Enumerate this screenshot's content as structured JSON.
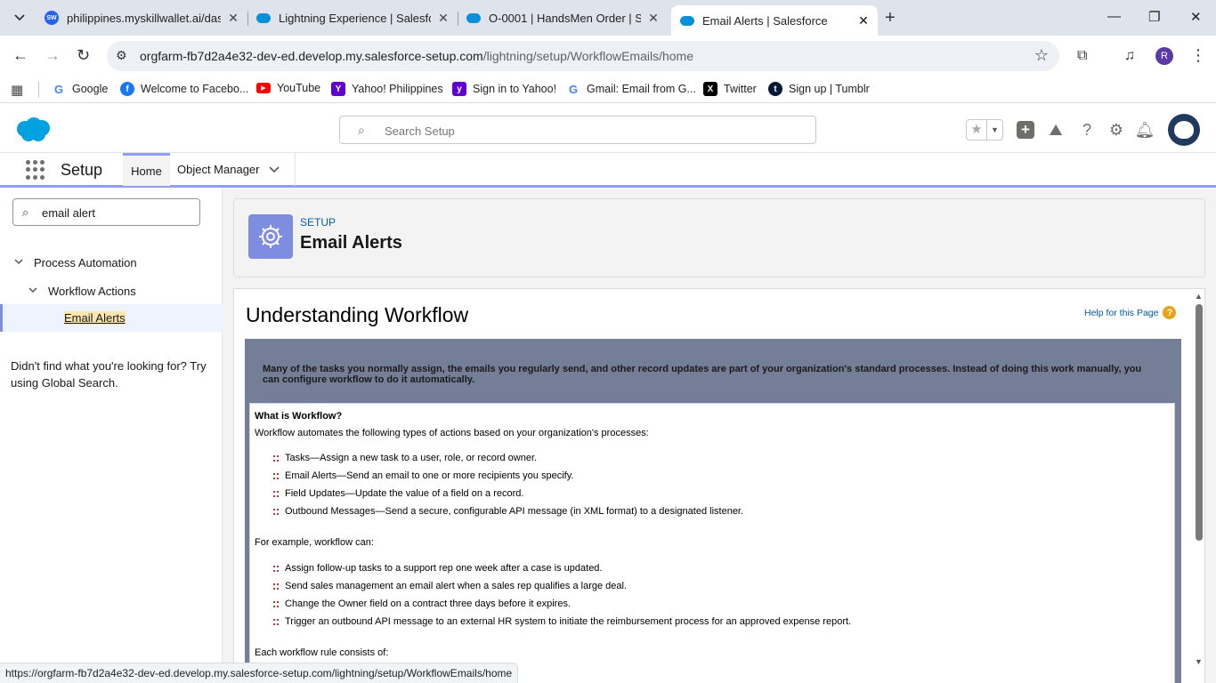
{
  "browser": {
    "tabs": [
      {
        "title": "philippines.myskillwallet.ai/dash",
        "icon": "skillwallet-icon"
      },
      {
        "title": "Lightning Experience | Salesforc",
        "icon": "salesforce-cloud-icon"
      },
      {
        "title": "O-0001 | HandsMen Order | Sal",
        "icon": "salesforce-cloud-icon"
      },
      {
        "title": "Email Alerts | Salesforce",
        "icon": "salesforce-cloud-icon",
        "active": true
      }
    ],
    "favicon_text": "SW",
    "url_host": "orgfarm-fb7d2a4e32-dev-ed.develop.my.salesforce-setup.com",
    "url_path": "/lightning/setup/WorkflowEmails/home",
    "profile_initial": "R",
    "bookmarks": [
      {
        "label": "Google",
        "icon": "google-icon",
        "color": "#4285f4",
        "glyph": "G"
      },
      {
        "label": "Welcome to Facebo...",
        "icon": "facebook-icon",
        "color": "#1877f2",
        "glyph": "f"
      },
      {
        "label": "YouTube",
        "icon": "youtube-icon",
        "color": "#ff0000",
        "glyph": "▶"
      },
      {
        "label": "Yahoo! Philippines",
        "icon": "yahoo-icon",
        "color": "#5f01d1",
        "glyph": "Y"
      },
      {
        "label": "Sign in to Yahoo!",
        "icon": "yahoo-icon",
        "color": "#6001d2",
        "glyph": "y"
      },
      {
        "label": "Gmail: Email from G...",
        "icon": "google-icon",
        "color": "#4285f4",
        "glyph": "G"
      },
      {
        "label": "Twitter",
        "icon": "x-icon",
        "color": "#000000",
        "glyph": "X"
      },
      {
        "label": "Sign up | Tumblr",
        "icon": "tumblr-icon",
        "color": "#001935",
        "glyph": "t"
      }
    ],
    "status_url": "https://orgfarm-fb7d2a4e32-dev-ed.develop.my.salesforce-setup.com/lightning/setup/WorkflowEmails/home"
  },
  "sf_header": {
    "search_placeholder": "Search Setup",
    "brand_color": "#00a1e0"
  },
  "setup_nav": {
    "title": "Setup",
    "home_label": "Home",
    "object_manager_label": "Object Manager"
  },
  "sidebar": {
    "quickfind_value": "email alert",
    "tree": {
      "level1": "Process Automation",
      "level2": "Workflow Actions",
      "level3": "Email Alerts"
    },
    "not_found_text": "Didn't find what you're looking for? Try using Global Search."
  },
  "page_header": {
    "eyebrow": "SETUP",
    "title": "Email Alerts"
  },
  "content": {
    "title": "Understanding Workflow",
    "help_link": "Help for this Page",
    "intro": "Many of the tasks you normally assign, the emails you regularly send, and other record updates are part of your organization's standard processes. Instead of doing this work manually, you can configure workflow to do it automatically.",
    "what_heading": "What is Workflow?",
    "what_text": "Workflow automates the following types of actions based on your organization's processes:",
    "action_types": [
      "Tasks—Assign a new task to a user, role, or record owner.",
      "Email Alerts—Send an email to one or more recipients you specify.",
      "Field Updates—Update the value of a field on a record.",
      "Outbound Messages—Send a secure, configurable API message (in XML format) to a designated listener."
    ],
    "example_intro": "For example, workflow can:",
    "examples": [
      "Assign follow-up tasks to a support rep one week after a case is updated.",
      "Send sales management an email alert when a sales rep qualifies a large deal.",
      "Change the Owner field on a contract three days before it expires.",
      "Trigger an outbound API message to an external HR system to initiate the reimbursement process for an approved expense report."
    ],
    "rule_intro": "Each workflow rule consists of:"
  }
}
